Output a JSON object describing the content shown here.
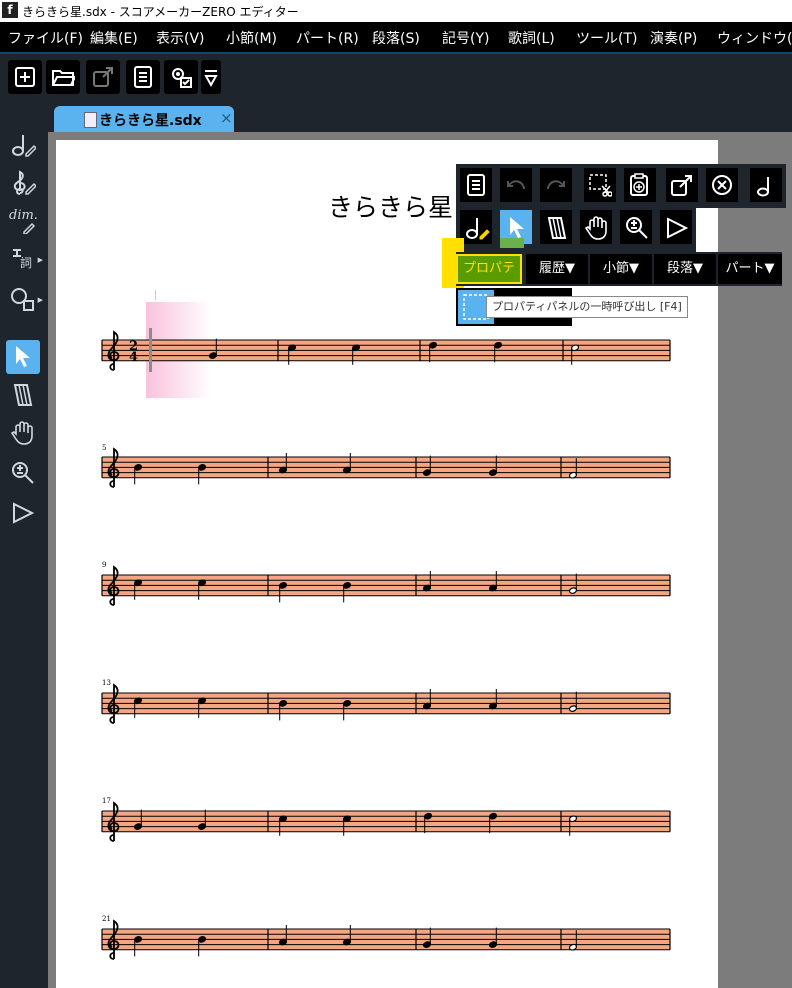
{
  "window": {
    "title": "きらきら星.sdx - スコアメーカーZERO エディター",
    "app_icon": "f"
  },
  "menu": [
    "ファイル(F)",
    "編集(E)",
    "表示(V)",
    "小節(M)",
    "パート(R)",
    "段落(S)",
    "記号(Y)",
    "歌詞(L)",
    "ツール(T)",
    "演奏(P)",
    "ウィンドウ(W"
  ],
  "toolbar": {
    "icons": [
      "new-file-icon",
      "open-folder-icon",
      "export-icon",
      "document-list-icon",
      "settings-check-icon",
      "dropdown-arrow-icon"
    ]
  },
  "tab": {
    "label": "きらきら星.sdx",
    "close": "×"
  },
  "left_tools": {
    "dim_label": "dim.",
    "lyrics_label": "詞",
    "icons": [
      "note-pencil-icon",
      "clef-pencil-icon",
      "dim-pencil-icon",
      "lyrics-icon",
      "shape-icon",
      "select-arrow-icon",
      "eraser-icon",
      "hand-icon",
      "zoom-icon",
      "play-icon"
    ],
    "selected": "select-arrow-icon"
  },
  "score": {
    "title": "きらきら星",
    "time_signature": {
      "top": "2",
      "bottom": "4"
    },
    "measure_numbers": [
      "5",
      "9",
      "13",
      "17",
      "21"
    ]
  },
  "float_panel": {
    "row1_icons": [
      "document-list-icon",
      "undo-icon",
      "redo-icon",
      "select-cut-icon",
      "paste-icon",
      "export-icon",
      "close-circle-icon",
      "note-icon"
    ],
    "row2_icons": [
      "note-pencil-icon",
      "select-arrow-icon",
      "eraser-icon",
      "hand-icon",
      "zoom-icon",
      "play-icon"
    ],
    "dropdowns": [
      "プロパティ",
      "履歴▼",
      "小節▼",
      "段落▼",
      "パート▼"
    ],
    "active_dropdown": "プロパティ",
    "tooltip": "プロパティパネルの一時呼び出し [F4]"
  },
  "colors": {
    "staff_bg": "#f4a582",
    "accent": "#5ab3ee",
    "highlight_yellow": "#ffe000",
    "property_green": "#5a9b00"
  }
}
